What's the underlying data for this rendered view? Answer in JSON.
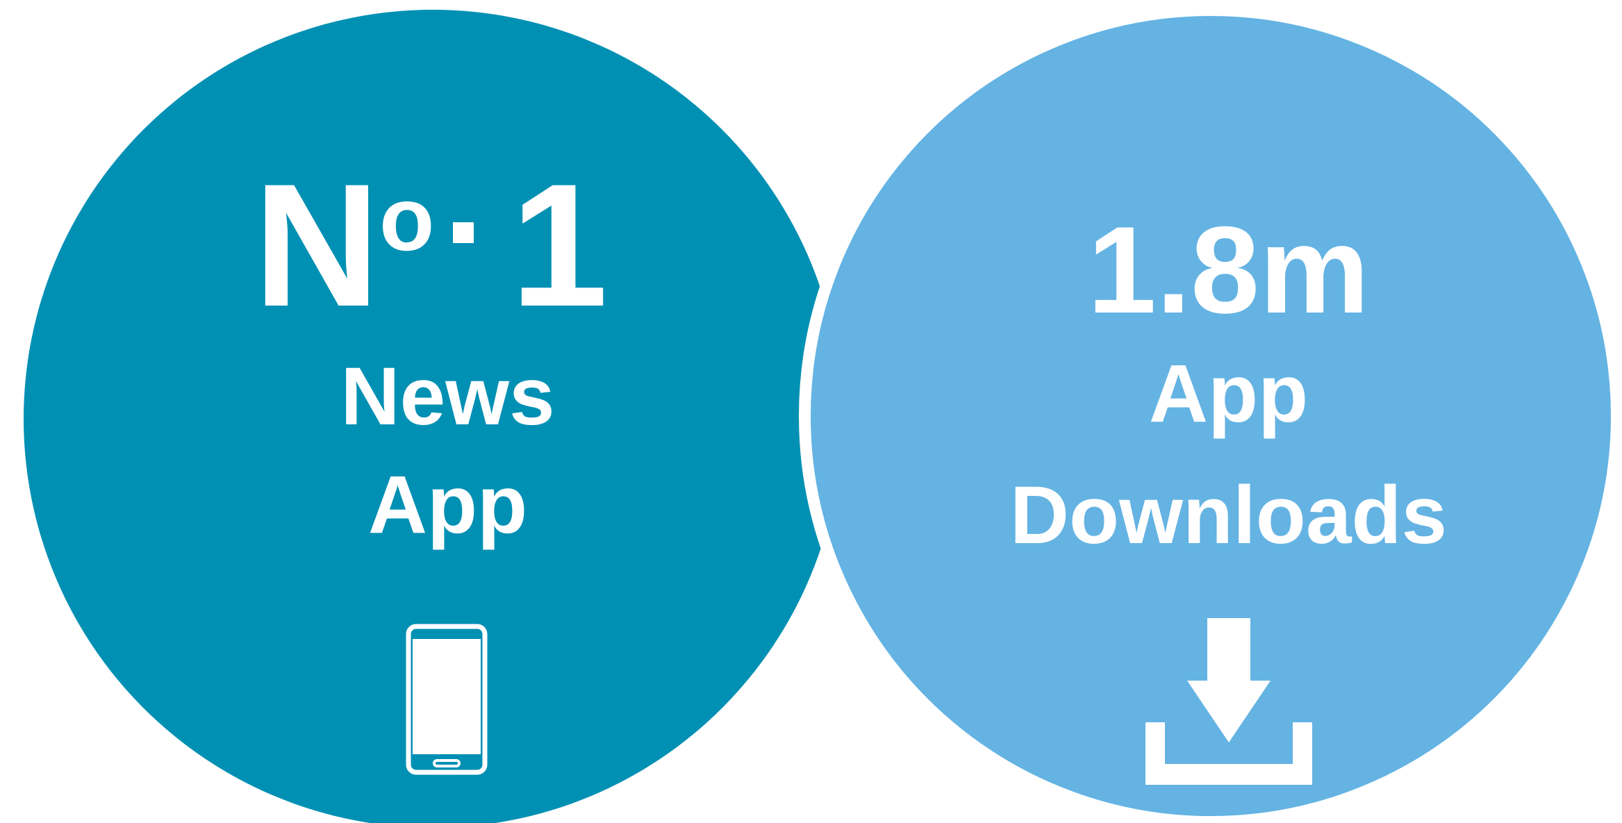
{
  "colors": {
    "left_circle": "#0090b4",
    "right_circle": "#64b3e3",
    "text": "#ffffff",
    "background": "#ffffff"
  },
  "left_panel": {
    "number_letter": "N",
    "number_superscript": "o",
    "number_value": "1",
    "label_line1": "News",
    "label_line2": "App",
    "icon": "smartphone-icon"
  },
  "right_panel": {
    "number": "1.8m",
    "label_line1": "App",
    "label_line2": "Downloads",
    "icon": "download-icon"
  }
}
